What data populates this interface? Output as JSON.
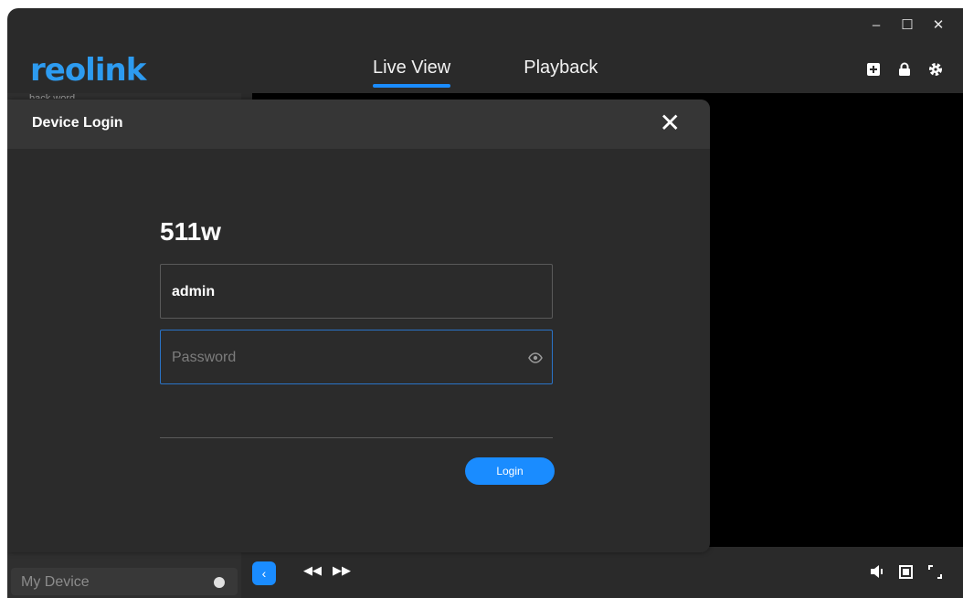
{
  "window": {
    "minimize": "–",
    "maximize": "☐",
    "close": "✕"
  },
  "header": {
    "logo": "reolink",
    "tabs": [
      {
        "label": "Live View",
        "active": true
      },
      {
        "label": "Playback",
        "active": false
      }
    ],
    "icons": [
      "add-icon",
      "lock-icon",
      "gear-icon"
    ]
  },
  "sidebar": {
    "partial_top_text": "back word",
    "my_device_label": "My Device"
  },
  "bottombar": {
    "collapse": "‹",
    "rewind": "◀◀",
    "forward": "▶▶",
    "icons": [
      "volume-icon",
      "stop-icon",
      "fullscreen-icon"
    ]
  },
  "modal": {
    "title": "Device Login",
    "close": "✕",
    "device_name": "511w",
    "username_value": "admin",
    "password_placeholder": "Password",
    "login_label": "Login"
  },
  "colors": {
    "accent": "#1a8cff",
    "logo": "#2d9bf0",
    "background": "#2a2a2a"
  }
}
